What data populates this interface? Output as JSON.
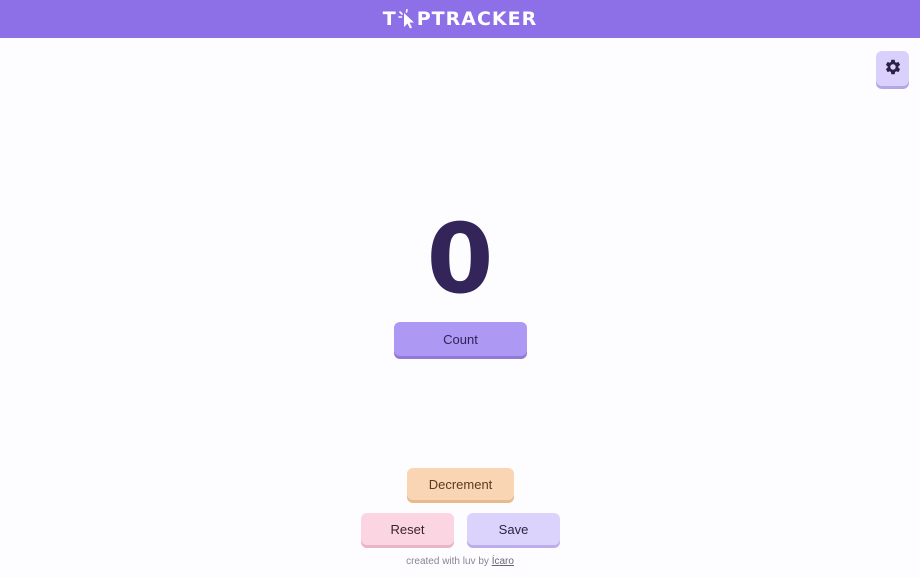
{
  "header": {
    "logo_text_left": "T",
    "logo_text_right": "PTRACKER",
    "background": "#8d6fe8"
  },
  "settings": {
    "icon": "gear-icon"
  },
  "counter": {
    "value": "0"
  },
  "buttons": {
    "count_label": "Count",
    "decrement_label": "Decrement",
    "reset_label": "Reset",
    "save_label": "Save"
  },
  "footer": {
    "text": "created with luv by ",
    "author_link": "Ícaro"
  },
  "colors": {
    "accent": "#8d6fe8",
    "count": "#ad98f4",
    "decrement": "#fad5b4",
    "reset": "#fbd5e1",
    "save": "#dcd3fd",
    "counter_text": "#33245a"
  }
}
